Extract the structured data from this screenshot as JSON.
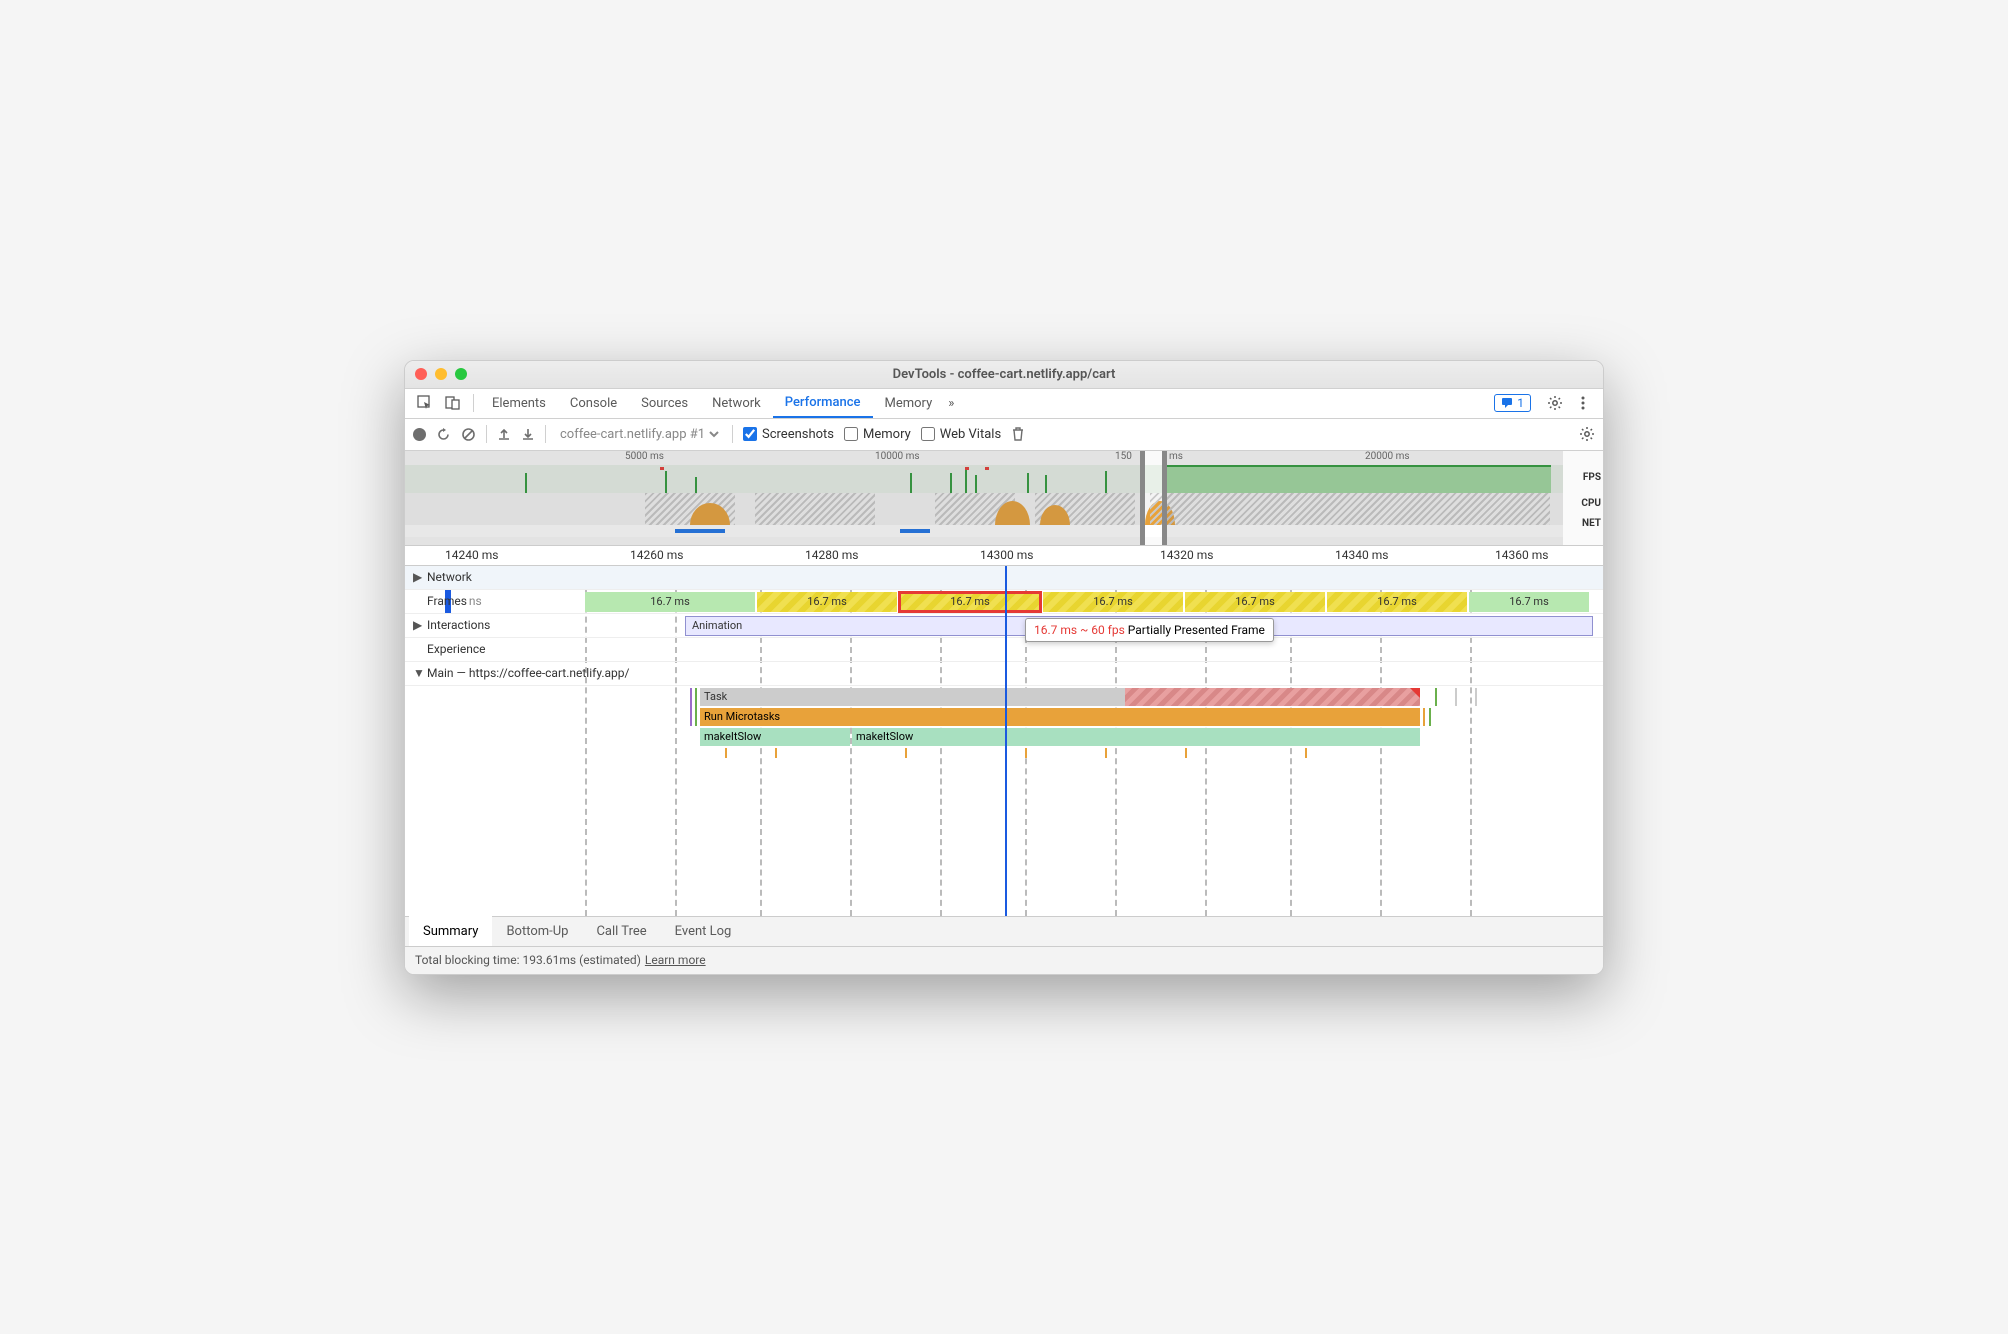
{
  "window": {
    "title": "DevTools - coffee-cart.netlify.app/cart"
  },
  "tabs": {
    "elements": "Elements",
    "console": "Console",
    "sources": "Sources",
    "network": "Network",
    "performance": "Performance",
    "memory": "Memory",
    "badge_count": "1"
  },
  "toolbar": {
    "profile_select": "coffee-cart.netlify.app #1",
    "screenshots": "Screenshots",
    "memory": "Memory",
    "webvitals": "Web Vitals"
  },
  "overview": {
    "ticks": [
      "5000 ms",
      "10000 ms",
      "150",
      "ms",
      "20000 ms"
    ],
    "labels": {
      "fps": "FPS",
      "cpu": "CPU",
      "net": "NET"
    }
  },
  "ruler": [
    "14240 ms",
    "14260 ms",
    "14280 ms",
    "14300 ms",
    "14320 ms",
    "14340 ms",
    "14360 ms"
  ],
  "tracks": {
    "network": "Network",
    "frames": "Frames",
    "interactions": "Interactions",
    "experience": "Experience",
    "main": "Main — https://coffee-cart.netlify.app/",
    "animation": "Animation",
    "frame_labels": [
      "16.7 ms",
      "16.7 ms",
      "16.7 ms",
      "16.7 ms",
      "16.7 ms",
      "16.7 ms",
      "16.7 ms"
    ],
    "frame_suffix": "ns",
    "tooltip_metric": "16.7 ms ~ 60 fps",
    "tooltip_desc": "Partially Presented Frame",
    "task": "Task",
    "microtasks": "Run Microtasks",
    "makeitslow": "makeItSlow",
    "makeitslow2": "makeItSlow"
  },
  "bottom_tabs": {
    "summary": "Summary",
    "bottomup": "Bottom-Up",
    "calltree": "Call Tree",
    "eventlog": "Event Log"
  },
  "status": {
    "text": "Total blocking time: 193.61ms (estimated)",
    "link": "Learn more"
  }
}
